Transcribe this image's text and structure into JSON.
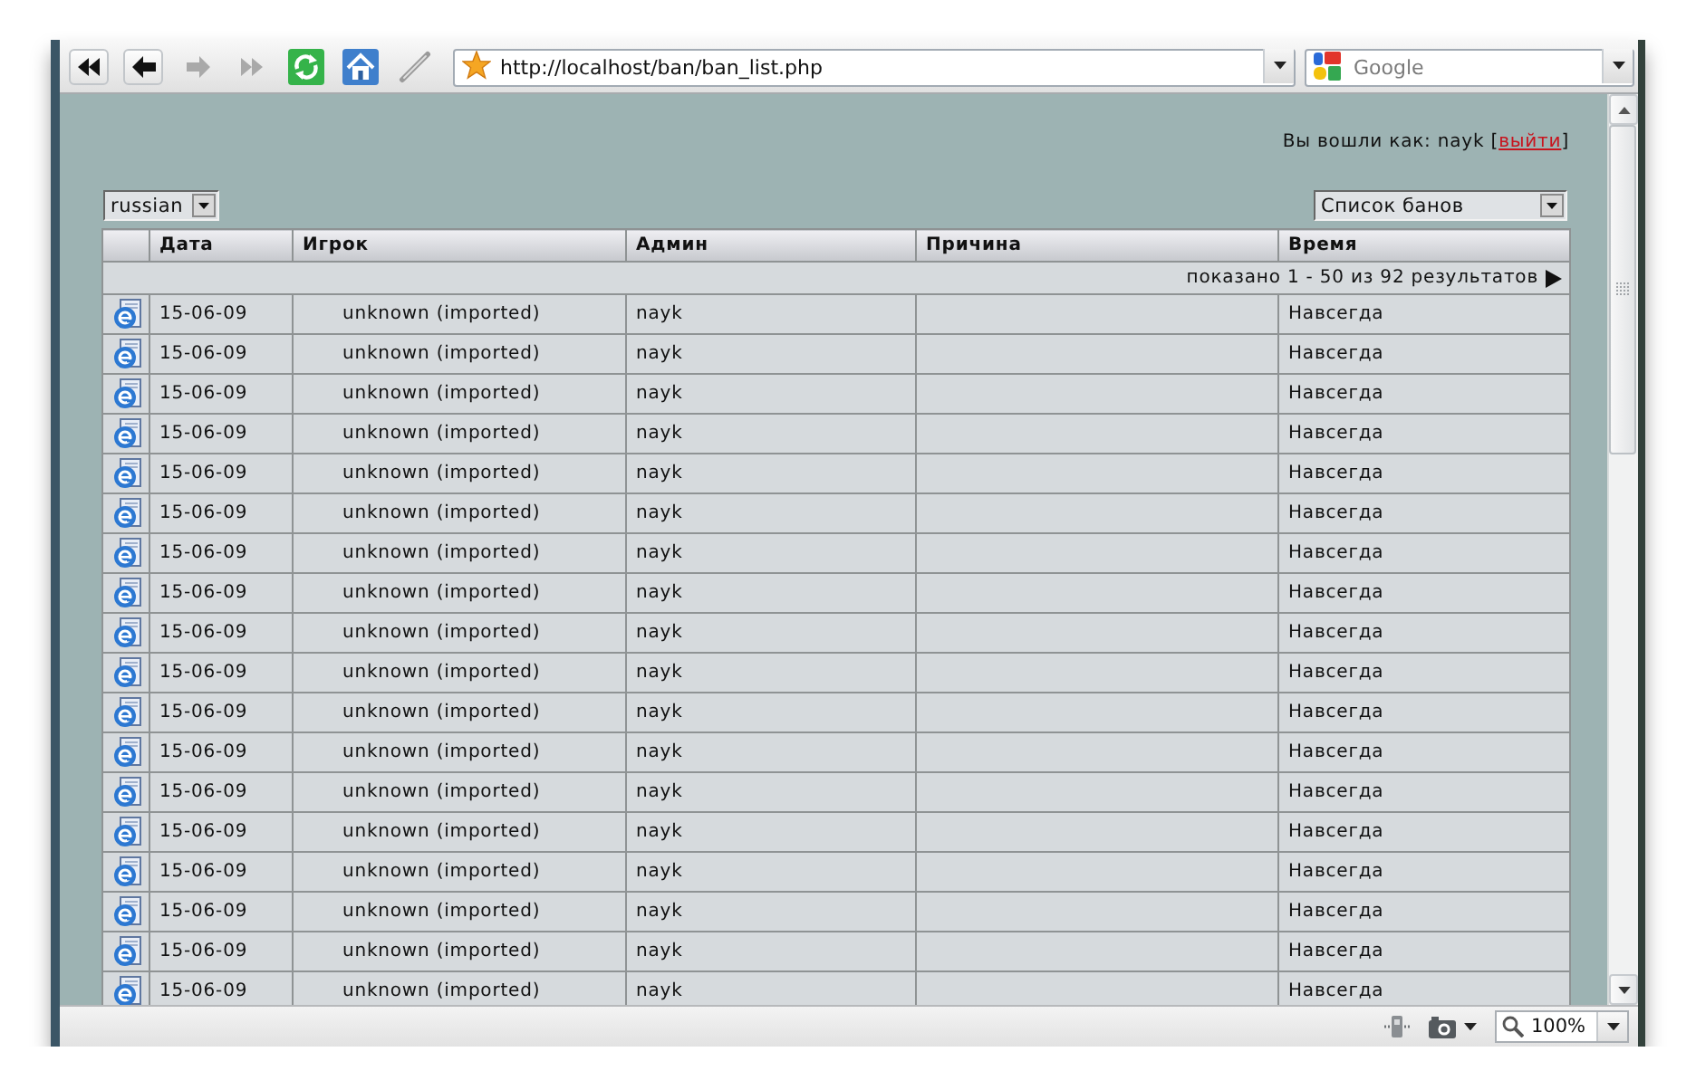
{
  "browser": {
    "nav_buttons": [
      {
        "kind": "first",
        "disabled": false
      },
      {
        "kind": "back",
        "disabled": false
      },
      {
        "kind": "forward",
        "disabled": true
      },
      {
        "kind": "last",
        "disabled": true
      },
      {
        "kind": "reload",
        "disabled": false
      },
      {
        "kind": "home",
        "disabled": false
      },
      {
        "kind": "pen",
        "disabled": false
      }
    ],
    "address": "http://localhost/ban/ban_list.php",
    "search": {
      "placeholder": "Google"
    }
  },
  "session": {
    "prefix": "Вы вошли как: nayk [",
    "logout_link": "выйти",
    "suffix": "]"
  },
  "language_select": {
    "value": "russian"
  },
  "view_select": {
    "value": "Список банов"
  },
  "table": {
    "columns": [
      "Дата",
      "Игрок",
      "Админ",
      "Причина",
      "Время"
    ],
    "pagination": "показано 1 - 50 из 92 результатов",
    "rows": [
      {
        "date": "15-06-09",
        "player": "unknown (imported)",
        "admin": "nayk",
        "duration": "Навсегда"
      },
      {
        "date": "15-06-09",
        "player": "unknown (imported)",
        "admin": "nayk",
        "duration": "Навсегда"
      },
      {
        "date": "15-06-09",
        "player": "unknown (imported)",
        "admin": "nayk",
        "duration": "Навсегда"
      },
      {
        "date": "15-06-09",
        "player": "unknown (imported)",
        "admin": "nayk",
        "duration": "Навсегда"
      },
      {
        "date": "15-06-09",
        "player": "unknown (imported)",
        "admin": "nayk",
        "duration": "Навсегда"
      },
      {
        "date": "15-06-09",
        "player": "unknown (imported)",
        "admin": "nayk",
        "duration": "Навсегда"
      },
      {
        "date": "15-06-09",
        "player": "unknown (imported)",
        "admin": "nayk",
        "duration": "Навсегда"
      },
      {
        "date": "15-06-09",
        "player": "unknown (imported)",
        "admin": "nayk",
        "duration": "Навсегда"
      },
      {
        "date": "15-06-09",
        "player": "unknown (imported)",
        "admin": "nayk",
        "duration": "Навсегда"
      },
      {
        "date": "15-06-09",
        "player": "unknown (imported)",
        "admin": "nayk",
        "duration": "Навсегда"
      },
      {
        "date": "15-06-09",
        "player": "unknown (imported)",
        "admin": "nayk",
        "duration": "Навсегда"
      },
      {
        "date": "15-06-09",
        "player": "unknown (imported)",
        "admin": "nayk",
        "duration": "Навсегда"
      },
      {
        "date": "15-06-09",
        "player": "unknown (imported)",
        "admin": "nayk",
        "duration": "Навсегда"
      },
      {
        "date": "15-06-09",
        "player": "unknown (imported)",
        "admin": "nayk",
        "duration": "Навсегда"
      },
      {
        "date": "15-06-09",
        "player": "unknown (imported)",
        "admin": "nayk",
        "duration": "Навсегда"
      },
      {
        "date": "15-06-09",
        "player": "unknown (imported)",
        "admin": "nayk",
        "duration": "Навсегда"
      },
      {
        "date": "15-06-09",
        "player": "unknown (imported)",
        "admin": "nayk",
        "duration": "Навсегда"
      },
      {
        "date": "15-06-09",
        "player": "unknown (imported)",
        "admin": "nayk",
        "duration": "Навсегда"
      }
    ]
  },
  "status_bar": {
    "zoom": "100%"
  }
}
